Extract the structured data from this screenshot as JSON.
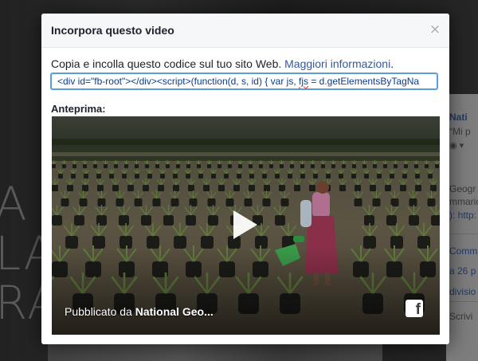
{
  "background": {
    "letters": [
      "A",
      "LA",
      "RA"
    ],
    "panel": {
      "name": "Nati",
      "quote": "“Mi p",
      "text_line1": "Geogr",
      "text_line2": "mmario",
      "link": "): http:",
      "comment": "Comm",
      "date": "a 26 p",
      "share": "divisio",
      "write": "Scrivi"
    }
  },
  "modal": {
    "title": "Incorpora questo video",
    "close_glyph": "×",
    "instructions": "Copia e incolla questo codice sul tuo sito Web.",
    "more_info_link": "Maggiori informazioni",
    "period": ".",
    "code_part1": "<div id=\"fb-root\"></div><script>(function(d, s, id) {  var js, ",
    "code_squiggle": "fjs",
    "code_part2": " = d.getElementsByTagNa",
    "preview_label": "Anteprima:"
  },
  "video": {
    "caption_prefix": "Pubblicato da ",
    "caption_author": "National Geo...",
    "badge_glyph": "f"
  },
  "colors": {
    "link": "#365899",
    "focus_border": "#5b9dd9",
    "header_bg": "#f6f7f9"
  }
}
